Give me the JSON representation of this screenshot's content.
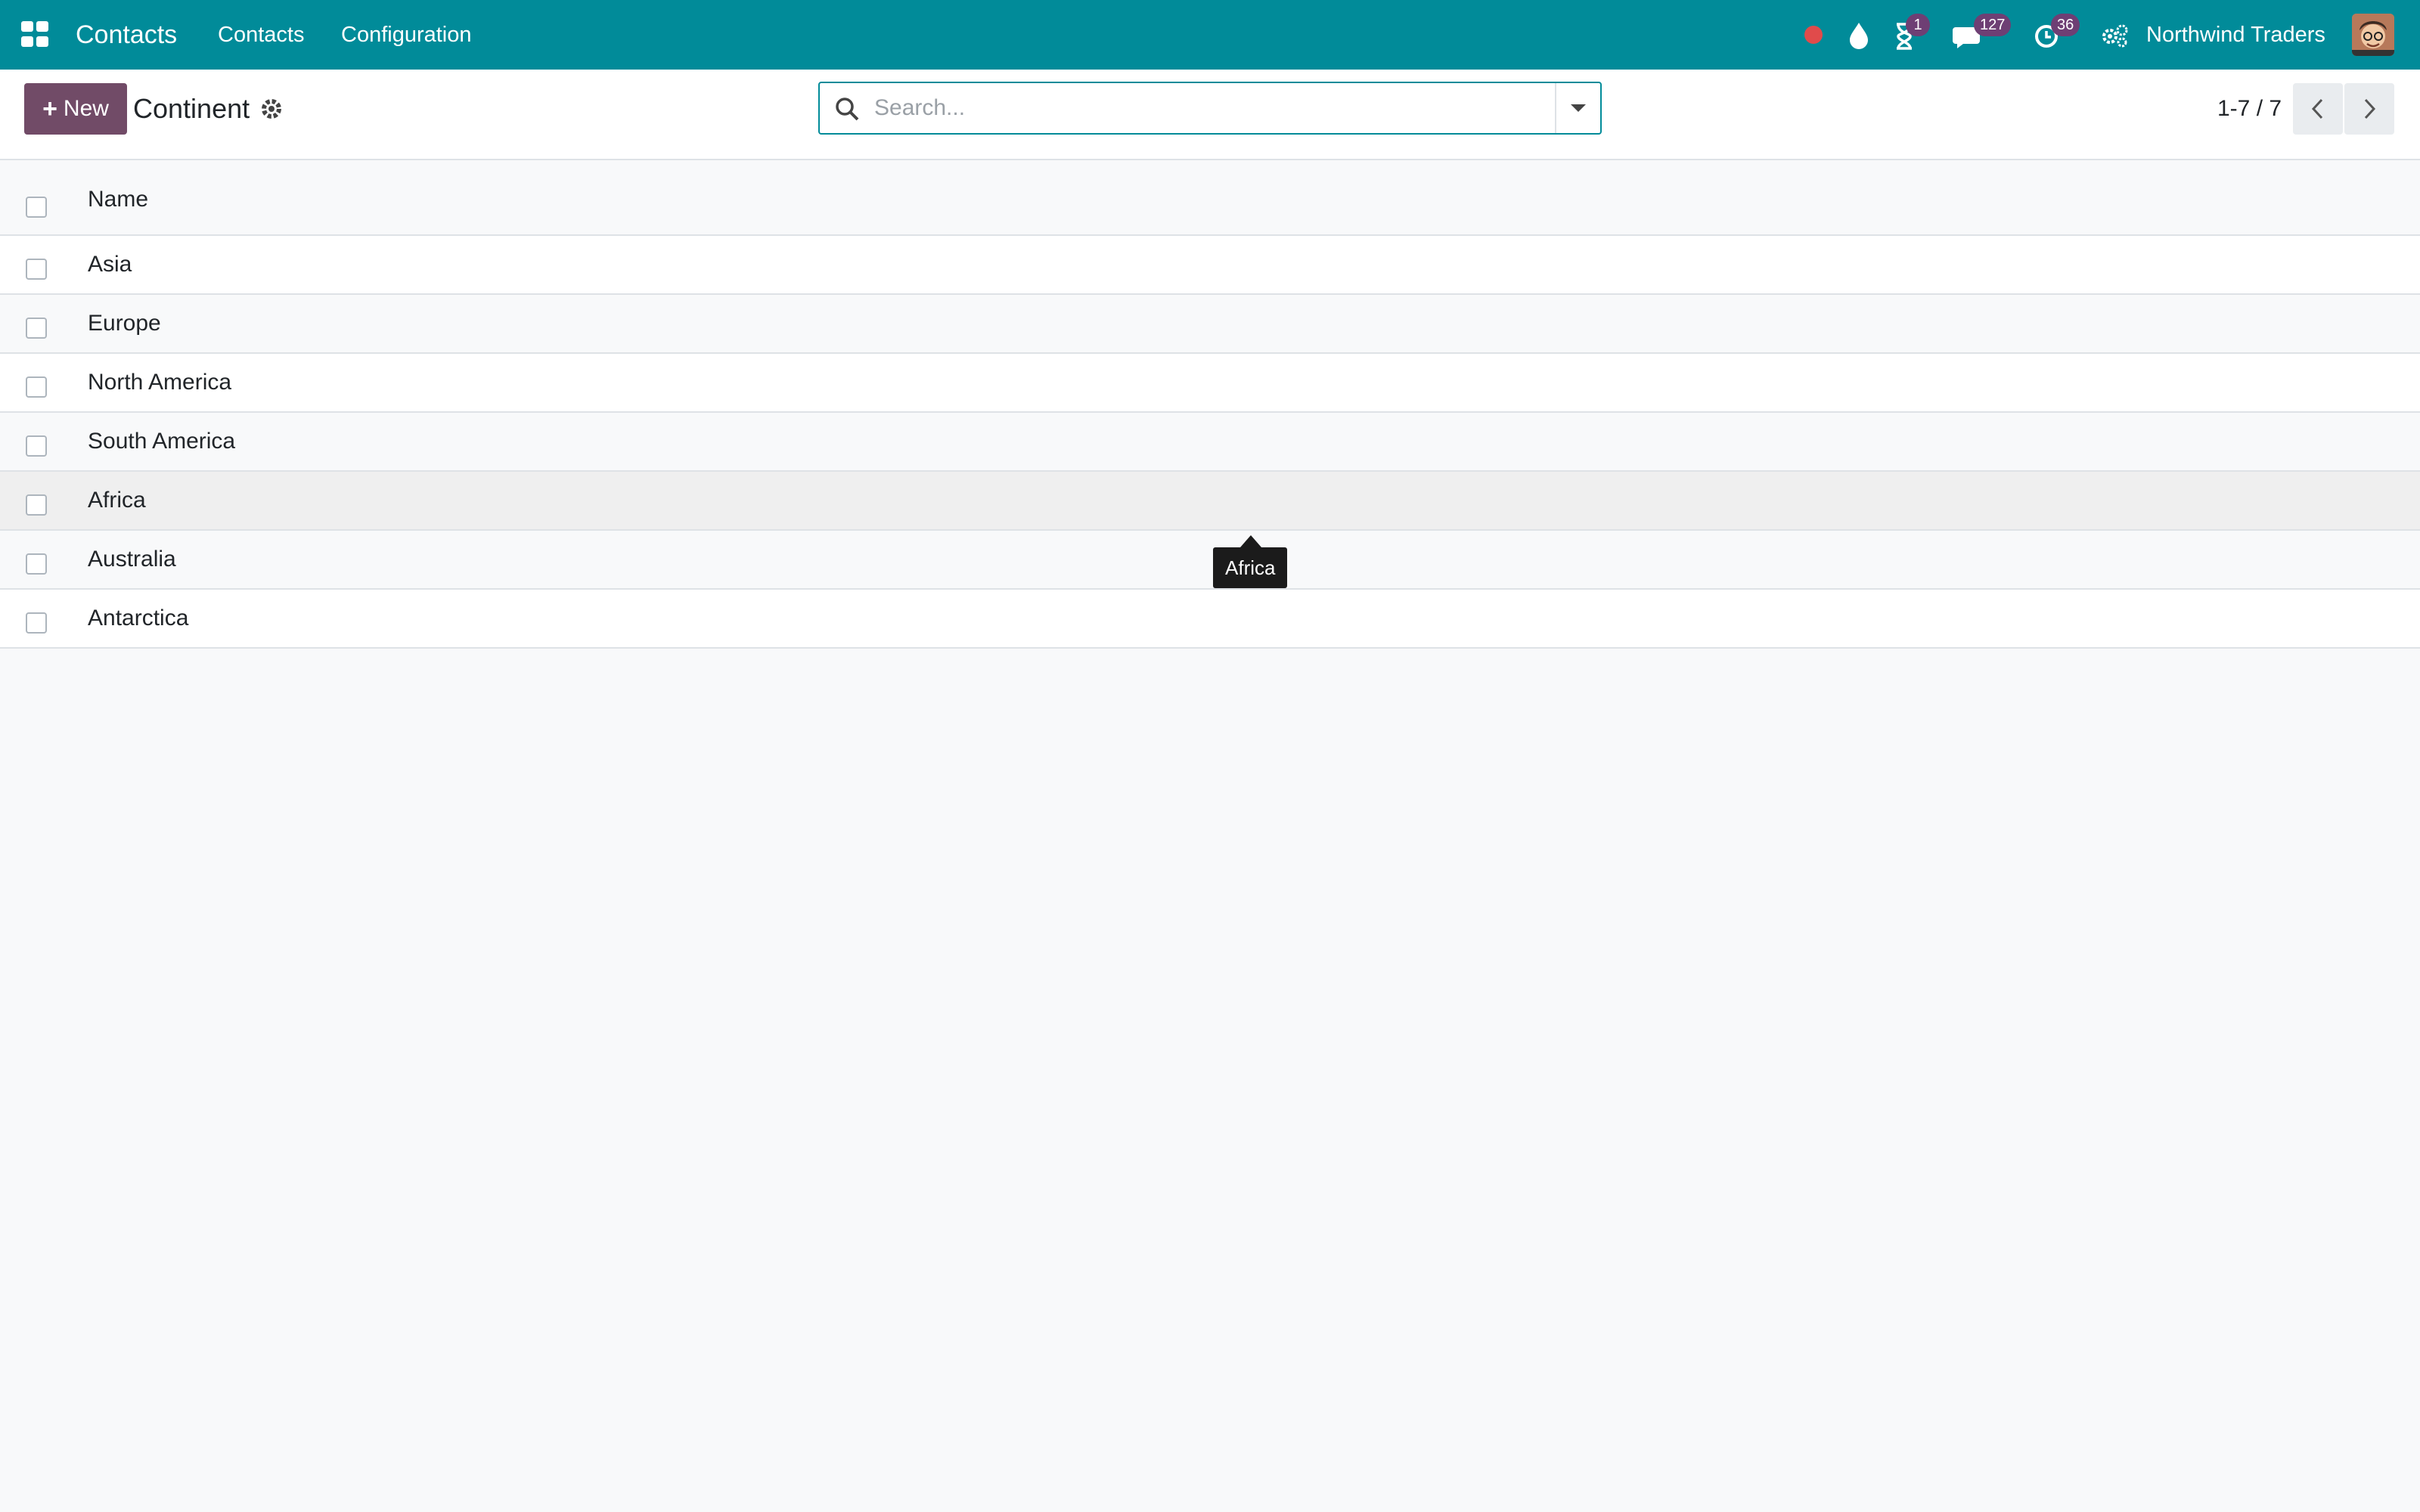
{
  "navbar": {
    "app_title": "Contacts",
    "menu": [
      "Contacts",
      "Configuration"
    ],
    "tray": {
      "record_dot_color": "#e04b4b",
      "activity_badge": "1",
      "messages_badge": "127",
      "timer_badge": "36"
    },
    "company": "Northwind Traders",
    "color": "#018b99",
    "badge_color": "#6e3f74"
  },
  "control_panel": {
    "new_label": "New",
    "title": "Continent",
    "search_placeholder": "Search...",
    "pager": "1-7 / 7",
    "accent": "#714b67"
  },
  "list": {
    "columns": [
      "Name"
    ],
    "rows": [
      {
        "name": "Asia"
      },
      {
        "name": "Europe"
      },
      {
        "name": "North America"
      },
      {
        "name": "South America"
      },
      {
        "name": "Africa"
      },
      {
        "name": "Australia"
      },
      {
        "name": "Antarctica"
      }
    ]
  },
  "tooltip": {
    "text": "Africa"
  }
}
